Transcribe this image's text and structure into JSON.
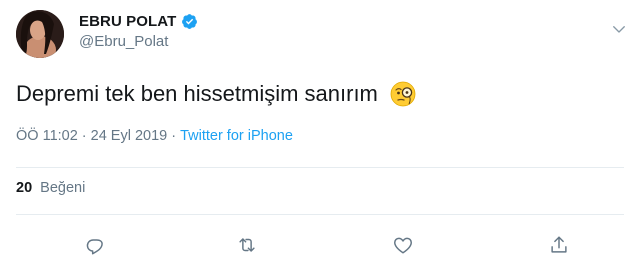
{
  "user": {
    "display_name": "EBRU POLAT",
    "handle": "@Ebru_Polat",
    "verified": true,
    "avatar_icon": "profile-photo"
  },
  "tweet": {
    "text": "Depremi tek ben hissetmişim sanırım",
    "emoji_icon": "face-with-monocle-emoji"
  },
  "meta": {
    "time": "ÖÖ 11:02",
    "separator": "·",
    "date": "24 Eyl 2019",
    "source": "Twitter for iPhone"
  },
  "stats": {
    "likes_count": "20",
    "likes_label": "Beğeni"
  },
  "actions": [
    {
      "name": "reply",
      "icon": "reply-icon"
    },
    {
      "name": "retweet",
      "icon": "retweet-icon"
    },
    {
      "name": "like",
      "icon": "heart-icon"
    },
    {
      "name": "share",
      "icon": "share-icon"
    }
  ],
  "colors": {
    "accent": "#1da1f2",
    "text": "#14171a",
    "muted": "#657786",
    "divider": "#e6ecf0"
  }
}
